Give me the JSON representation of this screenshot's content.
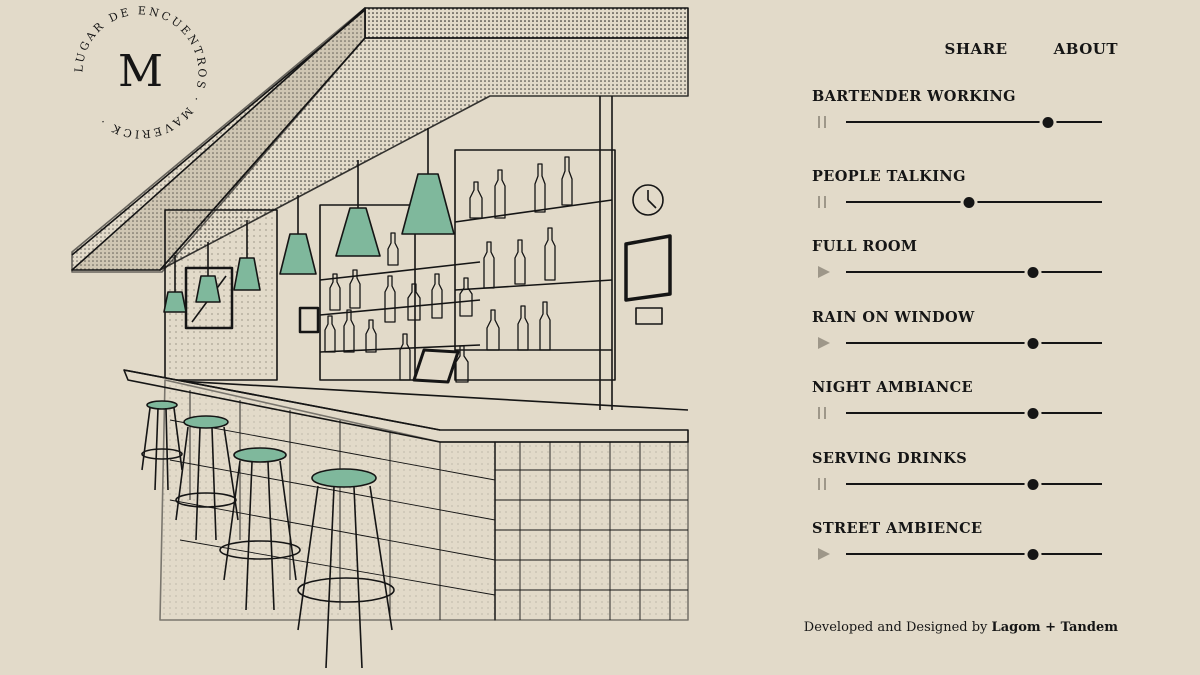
{
  "logo": {
    "monogram": "M",
    "ring_text": "LUGAR DE ENCUENTROS · MAVERICK ·"
  },
  "nav": {
    "share": "SHARE",
    "about": "ABOUT"
  },
  "sounds": [
    {
      "label": "BARTENDER WORKING",
      "state": "playing",
      "volume": 0.79
    },
    {
      "label": "PEOPLE TALKING",
      "state": "playing",
      "volume": 0.48
    },
    {
      "label": "FULL ROOM",
      "state": "paused",
      "volume": 0.73
    },
    {
      "label": "RAIN ON WINDOW",
      "state": "paused",
      "volume": 0.73
    },
    {
      "label": "NIGHT AMBIANCE",
      "state": "playing",
      "volume": 0.73
    },
    {
      "label": "SERVING DRINKS",
      "state": "playing",
      "volume": 0.73
    },
    {
      "label": "STREET AMBIENCE",
      "state": "paused",
      "volume": 0.73
    }
  ],
  "icons": {
    "playing": "pause-icon",
    "paused": "play-icon"
  },
  "credit": {
    "prefix": "Developed and Designed by",
    "authors": "Lagom + Tandem"
  },
  "colors": {
    "background": "#e2dac9",
    "ink": "#151515",
    "accent": "#7fb89c",
    "control_muted": "#9e9789"
  }
}
